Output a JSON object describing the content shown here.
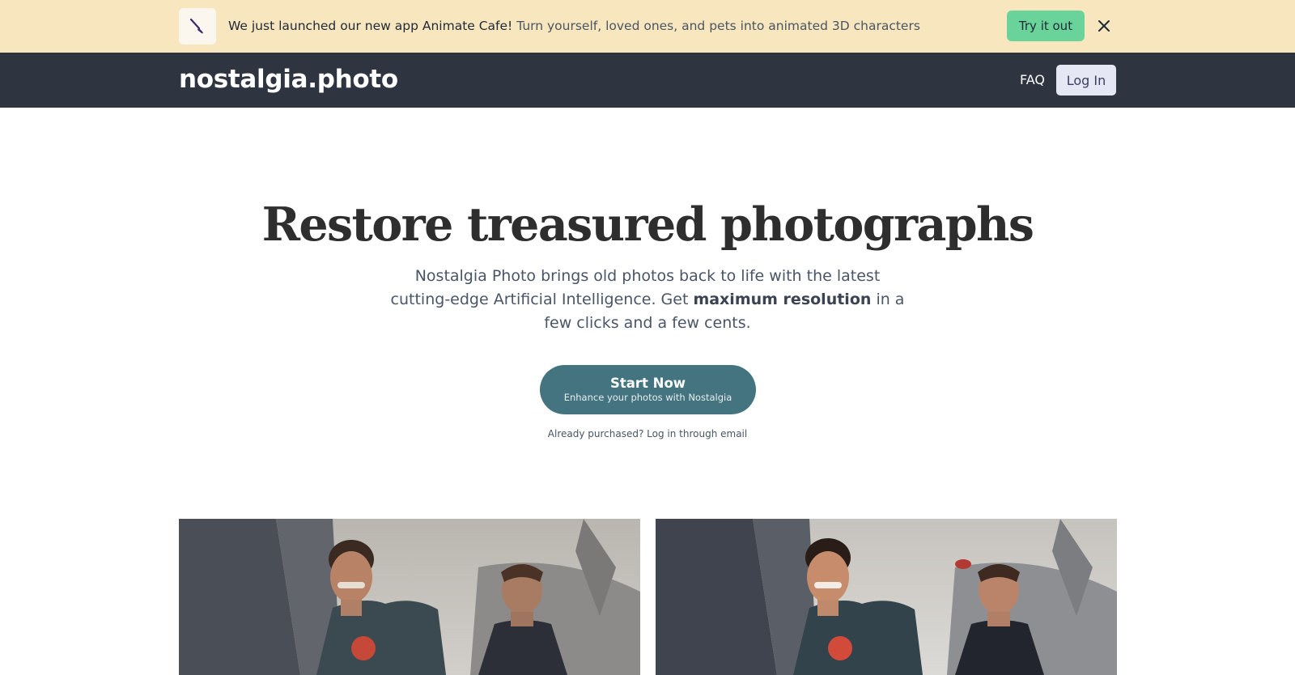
{
  "announcement": {
    "strong_text": "We just launched our new app Animate Cafe!",
    "rest_text": "Turn yourself, loved ones, and pets into animated 3D characters",
    "button_label": "Try it out",
    "icon": "paintbrush-icon",
    "close_icon": "close-icon"
  },
  "nav": {
    "logo": "nostalgia.photo",
    "faq": "FAQ",
    "login": "Log In"
  },
  "hero": {
    "title": "Restore treasured photographs",
    "subtitle_before": "Nostalgia Photo brings old photos back to life with the latest cutting-edge Artificial Intelligence. Get ",
    "subtitle_bold": "maximum resolution",
    "subtitle_after": " in a few clicks and a few cents.",
    "cta_title": "Start Now",
    "cta_subtitle": "Enhance your photos with Nostalgia",
    "already_purchased": "Already purchased? Log in through email"
  },
  "comparison": {
    "before_image": "old-photo-before-restoration",
    "after_image": "photo-after-restoration"
  },
  "colors": {
    "announcement_bg": "#f7e6be",
    "try_button": "#6ad39a",
    "nav_bg": "#2f3441",
    "cta_bg": "#43747f"
  }
}
